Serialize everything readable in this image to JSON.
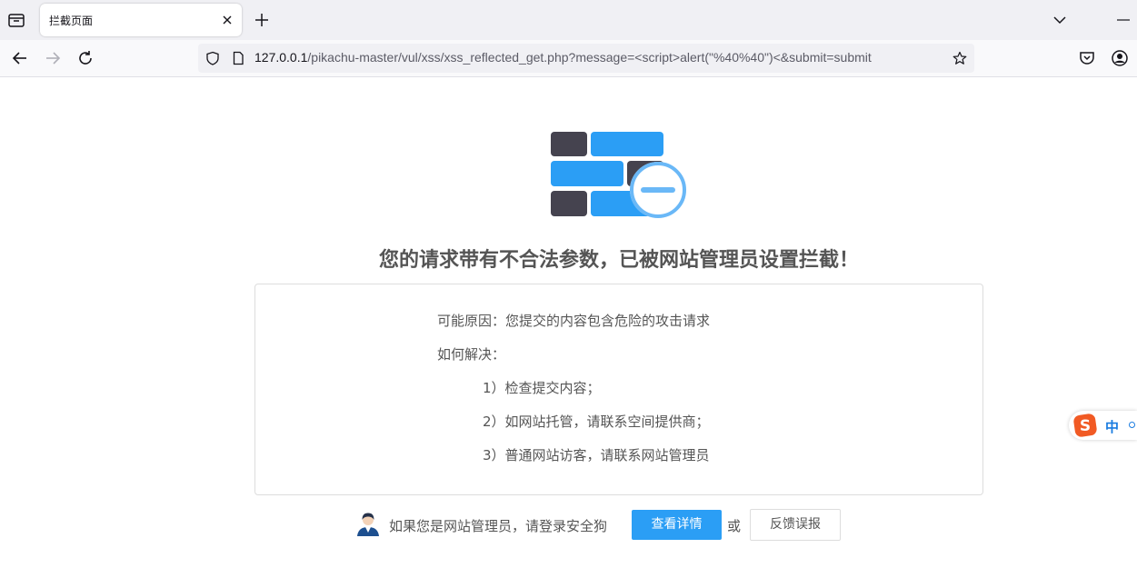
{
  "browser": {
    "tab_title": "拦截页面",
    "url_host": "127.0.0.1",
    "url_path": "/pikachu-master/vul/xss/xss_reflected_get.php?message=<script>alert(\"%40%40\")<&submit=submit"
  },
  "page": {
    "headline": "您的请求带有不合法参数，已被网站管理员设置拦截！",
    "reason": "可能原因：您提交的内容包含危险的攻击请求",
    "how_to_title": "如何解决：",
    "steps": [
      "1）检查提交内容；",
      "2）如网站托管，请联系空间提供商；",
      "3）普通网站访客，请联系网站管理员"
    ],
    "footer_text": "如果您是网站管理员，请登录安全狗",
    "detail_button": "查看详情",
    "or_text": "或",
    "feedback_button": "反馈误报"
  },
  "ime": {
    "lang": "中"
  },
  "colors": {
    "accent": "#2b9ef5",
    "brick_dark": "#45434f",
    "shield_blue": "#6ab8f7"
  }
}
